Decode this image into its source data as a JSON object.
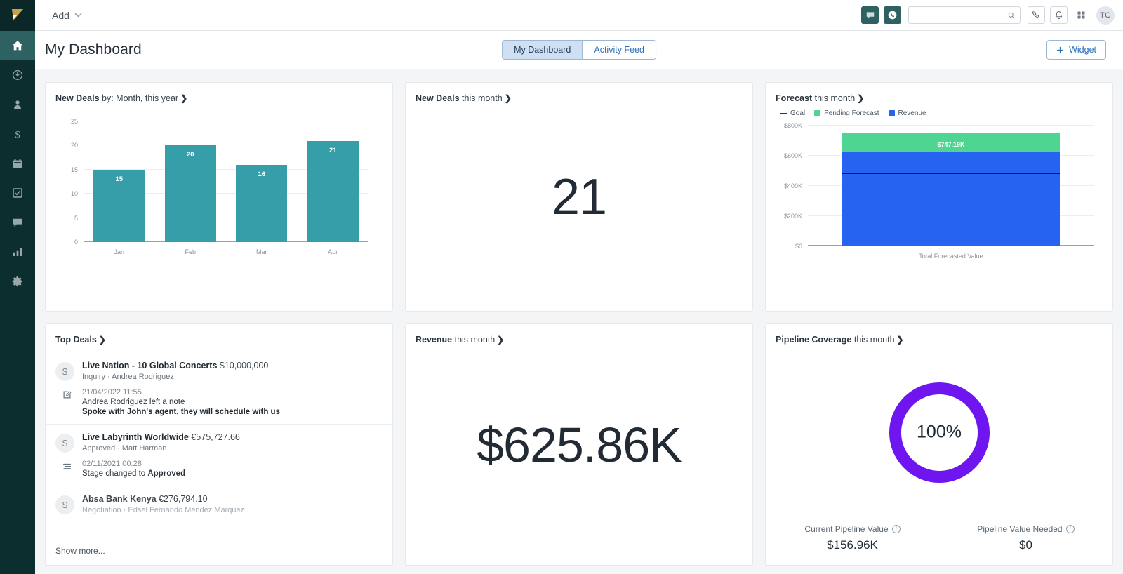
{
  "app": {
    "logo_icon": "flag-logo-icon"
  },
  "topbar": {
    "add_label": "Add",
    "chat_icon": "chat-bubble-icon",
    "whatsapp_icon": "whatsapp-icon",
    "search_placeholder": "",
    "search_value": "",
    "search_icon": "search-icon",
    "phone_icon": "phone-icon",
    "bell_icon": "bell-icon",
    "apps_icon": "grid-apps-icon",
    "avatar_initials": "TG"
  },
  "sidebar": {
    "items": [
      {
        "name": "home",
        "icon": "home-icon",
        "active": true
      },
      {
        "name": "activity",
        "icon": "power-activity-icon",
        "active": false
      },
      {
        "name": "contacts",
        "icon": "person-icon",
        "active": false
      },
      {
        "name": "deals",
        "icon": "dollar-icon",
        "active": false
      },
      {
        "name": "calendar",
        "icon": "calendar-icon",
        "active": false
      },
      {
        "name": "tasks",
        "icon": "checkbox-check-icon",
        "active": false
      },
      {
        "name": "messages",
        "icon": "chat-icon",
        "active": false
      },
      {
        "name": "reports",
        "icon": "bar-chart-icon",
        "active": false
      },
      {
        "name": "settings",
        "icon": "gear-icon",
        "active": false
      }
    ]
  },
  "header": {
    "title": "My Dashboard",
    "tabs": [
      {
        "label": "My Dashboard",
        "selected": true
      },
      {
        "label": "Activity Feed",
        "selected": false
      }
    ],
    "widget_button": {
      "label": "Widget",
      "icon": "plus-icon"
    }
  },
  "widgets": {
    "new_deals_chart": {
      "title_bold": "New Deals",
      "title_sub": "by: Month, this year",
      "chevron": "❯"
    },
    "new_deals_count": {
      "title_bold": "New Deals",
      "title_sub": "this month",
      "chevron": "❯",
      "value": "21"
    },
    "forecast": {
      "title_bold": "Forecast",
      "title_sub": "this month",
      "chevron": "❯",
      "legend": [
        {
          "label": "Goal",
          "type": "line",
          "color": "#2b343d"
        },
        {
          "label": "Pending Forecast",
          "type": "square",
          "color": "#4ed592"
        },
        {
          "label": "Revenue",
          "type": "square",
          "color": "#2563f0"
        }
      ]
    },
    "top_deals": {
      "title_bold": "Top Deals",
      "chevron": "❯",
      "show_more": "Show more...",
      "coin_icon": "dollar-circle-icon",
      "rows": [
        {
          "name": "Live Nation - 10 Global Concerts",
          "amount": "$10,000,000",
          "meta": "Inquiry · Andrea Rodriguez",
          "faded": false,
          "activity": {
            "icon": "note-edit-icon",
            "time": "21/04/2022 11:55",
            "line1": "Andrea Rodriguez left a note",
            "line2": "Spoke with John's agent, they will schedule with us"
          }
        },
        {
          "name": "Live Labyrinth Worldwide",
          "amount": "€575,727.66",
          "meta": "Approved · Matt Harman",
          "faded": false,
          "activity": {
            "icon": "stage-change-icon",
            "time": "02/11/2021 00:28",
            "line1": "Stage changed to Approved",
            "line2": ""
          }
        },
        {
          "name": "Absa Bank Kenya",
          "amount": "€276,794.10",
          "meta": "Negotiation · Edsel Fernando Mendez Marquez",
          "faded": true,
          "activity": null
        }
      ]
    },
    "revenue": {
      "title_bold": "Revenue",
      "title_sub": "this month",
      "chevron": "❯",
      "value": "$625.86K"
    },
    "pipeline_coverage": {
      "title_bold": "Pipeline Coverage",
      "title_sub": "this month",
      "chevron": "❯",
      "percent_label": "100%",
      "ring_color": "#6e15f0",
      "stats": [
        {
          "caption": "Current Pipeline Value",
          "info_icon": "info-icon",
          "value": "$156.96K"
        },
        {
          "caption": "Pipeline Value Needed",
          "info_icon": "info-icon",
          "value": "$0"
        }
      ]
    }
  },
  "chart_data": [
    {
      "type": "bar",
      "id": "new-deals-by-month",
      "title": "New Deals by: Month, this year",
      "categories": [
        "Jan",
        "Feb",
        "Mar",
        "Apr"
      ],
      "values": [
        15,
        20,
        16,
        21
      ],
      "data_labels": [
        "15",
        "20",
        "16",
        "21"
      ],
      "yticks": [
        0,
        5,
        10,
        15,
        20,
        25
      ],
      "ytick_labels": [
        "0",
        "5",
        "10",
        "15",
        "20",
        "25"
      ],
      "ylim": [
        0,
        25
      ],
      "xlabel": "",
      "ylabel": "",
      "grid": true,
      "legend": "none",
      "series_color": "#359ea8"
    },
    {
      "type": "bar",
      "id": "forecast-total",
      "title": "Forecast this month",
      "categories": [
        "Total Forecasted Value"
      ],
      "stacked": true,
      "series": [
        {
          "name": "Revenue",
          "values": [
            625860
          ],
          "color": "#2563f0"
        },
        {
          "name": "Pending Forecast",
          "values": [
            121330
          ],
          "color": "#4ed592"
        }
      ],
      "total_label": "$747.19K",
      "total_value": 747190,
      "goal_line": {
        "name": "Goal",
        "value": 480000,
        "color": "#161c22"
      },
      "yticks": [
        0,
        200000,
        400000,
        600000,
        800000
      ],
      "ytick_labels": [
        "$0",
        "$200K",
        "$400K",
        "$600K",
        "$800K"
      ],
      "ylim": [
        0,
        800000
      ],
      "xlabel": "Total Forecasted Value",
      "ylabel": "",
      "grid": true,
      "legend": "top-left"
    },
    {
      "type": "pie",
      "id": "pipeline-coverage-donut",
      "title": "Pipeline Coverage this month",
      "variant": "donut",
      "center_label": "100%",
      "values": [
        100
      ],
      "labels": [
        "Coverage"
      ],
      "colors": [
        "#6e15f0"
      ],
      "ylim": [
        0,
        100
      ]
    },
    {
      "type": "table",
      "id": "kpi-values",
      "title": "KPI single values",
      "categories": [
        "New Deals this month",
        "Revenue this month",
        "Current Pipeline Value",
        "Pipeline Value Needed"
      ],
      "values": [
        "21",
        "$625.86K",
        "$156.96K",
        "$0"
      ]
    }
  ]
}
